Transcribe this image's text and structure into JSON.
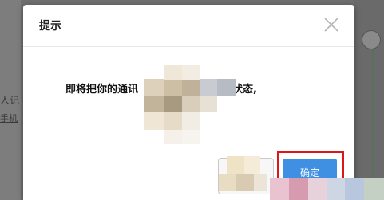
{
  "background": {
    "left_text": "人记",
    "left_link": "手机"
  },
  "dialog": {
    "title": "提示",
    "message_start": "即将把你的通讯",
    "message_end": "前的状态,",
    "ok_label": "确定",
    "cancel_label": ""
  },
  "colors": {
    "accent": "#3f8fe3",
    "highlight": "#e0151a"
  },
  "icons": {
    "close": "close-icon"
  }
}
